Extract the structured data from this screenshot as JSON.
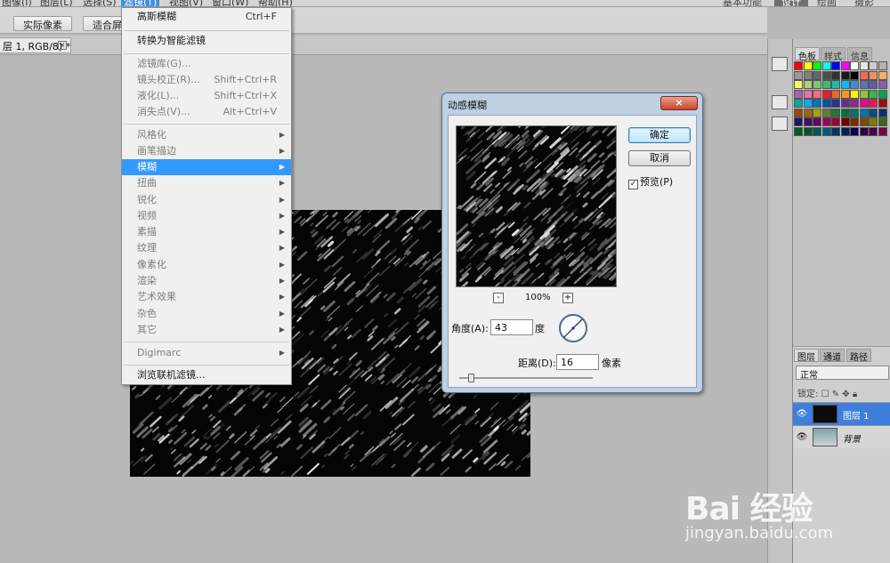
{
  "menubar": {
    "items": [
      "图像(I)",
      "图层(L)",
      "选择(S)",
      "滤镜(T)",
      "视图(V)",
      "窗口(W)",
      "帮助(H)"
    ],
    "workspaces": [
      "基本功能",
      "设计",
      "绘画",
      "摄影"
    ]
  },
  "optbar": {
    "actual_pixels": "实际像素",
    "fit_screen": "适合屏"
  },
  "document": {
    "tab_label": "层 1, RGB/8) *",
    "close": "×"
  },
  "filter_menu": {
    "items": [
      {
        "label": "高斯模糊",
        "shortcut": "Ctrl+F"
      },
      {
        "label": "转换为智能滤镜"
      },
      {
        "label": "滤镜库(G)..."
      },
      {
        "label": "镜头校正(R)...",
        "shortcut": "Shift+Ctrl+R"
      },
      {
        "label": "液化(L)...",
        "shortcut": "Shift+Ctrl+X"
      },
      {
        "label": "消失点(V)...",
        "shortcut": "Alt+Ctrl+V"
      },
      {
        "label": "风格化"
      },
      {
        "label": "画笔描边"
      },
      {
        "label": "模糊"
      },
      {
        "label": "扭曲"
      },
      {
        "label": "锐化"
      },
      {
        "label": "视频"
      },
      {
        "label": "素描"
      },
      {
        "label": "纹理"
      },
      {
        "label": "像素化"
      },
      {
        "label": "渲染"
      },
      {
        "label": "艺术效果"
      },
      {
        "label": "杂色"
      },
      {
        "label": "其它"
      },
      {
        "label": "Digimarc"
      },
      {
        "label": "浏览联机滤镜..."
      }
    ]
  },
  "dialog": {
    "title": "动感模糊",
    "close": "×",
    "ok": "确定",
    "cancel": "取消",
    "preview_label": "预览(P)",
    "preview_checked": "✓",
    "zoom_out": "-",
    "zoom_in": "+",
    "zoom": "100%",
    "angle_label": "角度(A):",
    "angle_value": "43",
    "angle_unit": "度",
    "distance_label": "距离(D):",
    "distance_value": "16",
    "distance_unit": "像素",
    "distance_slider_fraction": 0.05
  },
  "panels": {
    "tabs": [
      "色板",
      "样式",
      "信息"
    ],
    "layer_tabs": [
      "图层",
      "通道",
      "路径"
    ],
    "blend_mode": "正常",
    "lock_label": "锁定:",
    "layers": [
      {
        "name": "图层 1",
        "selected": true
      },
      {
        "name": "背景",
        "selected": false
      }
    ],
    "swatch_colors": [
      "#ff0000",
      "#ffff00",
      "#00ff00",
      "#00ffff",
      "#0000ff",
      "#ff00ff",
      "#ffffff",
      "#e6e6e6",
      "#cccccc",
      "#b3b3b3",
      "#999999",
      "#808080",
      "#666666",
      "#4d4d4d",
      "#333333",
      "#1a1a1a",
      "#000000",
      "#f26c4f",
      "#f68e56",
      "#fbaf5c",
      "#fff467",
      "#acd372",
      "#7dc473",
      "#3cb878",
      "#1cbbb4",
      "#00bff3",
      "#438cca",
      "#5574b9",
      "#605ca8",
      "#855fa8",
      "#a763a8",
      "#f06ea9",
      "#f26d7d",
      "#ed1c24",
      "#f26522",
      "#f7941d",
      "#fff200",
      "#8dc63f",
      "#39b54a",
      "#00a651",
      "#00a99d",
      "#00aeef",
      "#0072bc",
      "#0054a6",
      "#2e3192",
      "#662d91",
      "#92278f",
      "#ec008c",
      "#ed145b",
      "#9e0b0f",
      "#a0410d",
      "#a36209",
      "#aba000",
      "#598527",
      "#1a7b30",
      "#007236",
      "#00746b",
      "#0076a3",
      "#004b80",
      "#003471",
      "#1b1464",
      "#440e62",
      "#630460",
      "#9e005d",
      "#9e0039",
      "#790000",
      "#7b2e00",
      "#7d4900",
      "#827b00",
      "#406618",
      "#005e20",
      "#005826",
      "#005952",
      "#005b7f",
      "#003663",
      "#002157",
      "#0d004c",
      "#32004b",
      "#4b0049",
      "#7b0046",
      "#7a0026",
      "#c7b299",
      "#998675",
      "#736357",
      "#534741",
      "#37302d",
      "#c69c6d",
      "#a67c52",
      "#8c6239",
      "#754c24",
      "#603913",
      "#ffffff",
      "#000000",
      "#ff0000",
      "#00ff00"
    ]
  },
  "watermark": {
    "logo": "Bai 经验",
    "url": "jingyan.baidu.com"
  }
}
